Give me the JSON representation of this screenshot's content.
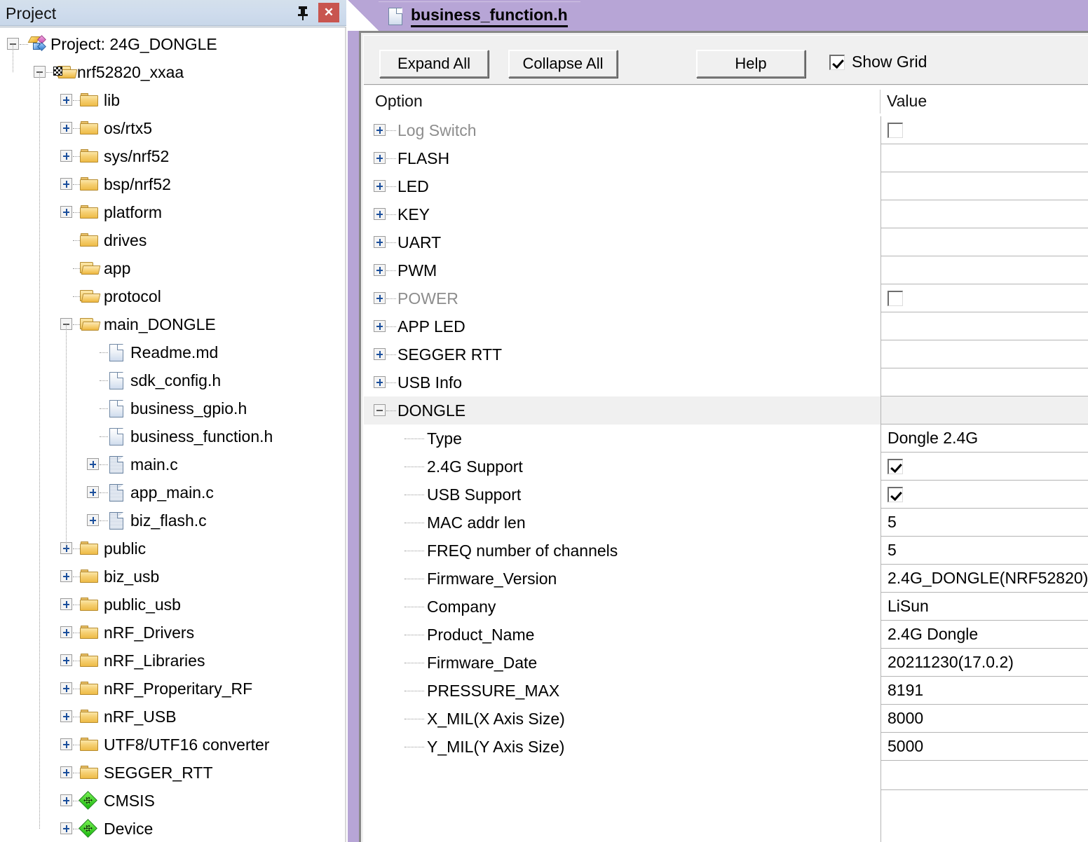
{
  "project_panel": {
    "title": "Project",
    "pin_icon": "pushpin-icon",
    "close_icon": "close-icon",
    "tree": [
      {
        "label": "Project: 24G_DONGLE",
        "depth": 0,
        "icon": "project-icon",
        "expander": "minus"
      },
      {
        "label": "nrf52820_xxaa",
        "depth": 1,
        "icon": "target-folder-icon",
        "expander": "minus"
      },
      {
        "label": "lib",
        "depth": 2,
        "icon": "folder-closed-icon",
        "expander": "plus"
      },
      {
        "label": "os/rtx5",
        "depth": 2,
        "icon": "folder-closed-icon",
        "expander": "plus"
      },
      {
        "label": "sys/nrf52",
        "depth": 2,
        "icon": "folder-closed-icon",
        "expander": "plus"
      },
      {
        "label": "bsp/nrf52",
        "depth": 2,
        "icon": "folder-closed-icon",
        "expander": "plus"
      },
      {
        "label": "platform",
        "depth": 2,
        "icon": "folder-closed-icon",
        "expander": "plus"
      },
      {
        "label": "drives",
        "depth": 2,
        "icon": "folder-closed-icon",
        "expander": "none"
      },
      {
        "label": "app",
        "depth": 2,
        "icon": "folder-open-icon",
        "expander": "none"
      },
      {
        "label": "protocol",
        "depth": 2,
        "icon": "folder-open-icon",
        "expander": "none"
      },
      {
        "label": "main_DONGLE",
        "depth": 2,
        "icon": "folder-open-icon",
        "expander": "minus"
      },
      {
        "label": "Readme.md",
        "depth": 3,
        "icon": "document-icon",
        "expander": "none"
      },
      {
        "label": "sdk_config.h",
        "depth": 3,
        "icon": "document-icon",
        "expander": "none"
      },
      {
        "label": "business_gpio.h",
        "depth": 3,
        "icon": "document-icon",
        "expander": "none"
      },
      {
        "label": "business_function.h",
        "depth": 3,
        "icon": "document-icon",
        "expander": "none"
      },
      {
        "label": "main.c",
        "depth": 3,
        "icon": "c-source-icon",
        "expander": "plus"
      },
      {
        "label": "app_main.c",
        "depth": 3,
        "icon": "c-source-icon",
        "expander": "plus"
      },
      {
        "label": "biz_flash.c",
        "depth": 3,
        "icon": "c-source-icon",
        "expander": "plus"
      },
      {
        "label": "public",
        "depth": 2,
        "icon": "folder-closed-icon",
        "expander": "plus"
      },
      {
        "label": "biz_usb",
        "depth": 2,
        "icon": "folder-closed-icon",
        "expander": "plus"
      },
      {
        "label": "public_usb",
        "depth": 2,
        "icon": "folder-closed-icon",
        "expander": "plus"
      },
      {
        "label": "nRF_Drivers",
        "depth": 2,
        "icon": "folder-closed-icon",
        "expander": "plus"
      },
      {
        "label": "nRF_Libraries",
        "depth": 2,
        "icon": "folder-closed-icon",
        "expander": "plus"
      },
      {
        "label": "nRF_Properitary_RF",
        "depth": 2,
        "icon": "folder-closed-icon",
        "expander": "plus"
      },
      {
        "label": "nRF_USB",
        "depth": 2,
        "icon": "folder-closed-icon",
        "expander": "plus"
      },
      {
        "label": "UTF8/UTF16 converter",
        "depth": 2,
        "icon": "folder-closed-icon",
        "expander": "plus"
      },
      {
        "label": "SEGGER_RTT",
        "depth": 2,
        "icon": "folder-closed-icon",
        "expander": "plus"
      },
      {
        "label": "CMSIS",
        "depth": 2,
        "icon": "green-diamond-icon",
        "expander": "plus"
      },
      {
        "label": "Device",
        "depth": 2,
        "icon": "green-diamond-icon",
        "expander": "plus"
      }
    ]
  },
  "editor": {
    "tab": {
      "label": "business_function.h",
      "icon": "document-icon",
      "active": true
    },
    "toolbar": {
      "expand_all_label": "Expand All",
      "collapse_all_label": "Collapse All",
      "help_label": "Help",
      "show_grid_label": "Show Grid",
      "show_grid_checked": true
    },
    "grid": {
      "header": {
        "option": "Option",
        "value": "Value"
      },
      "rows": [
        {
          "label": "Log Switch",
          "depth": 0,
          "expander": "plus",
          "disabled": true,
          "value_type": "checkbox",
          "checked": false,
          "value": ""
        },
        {
          "label": "FLASH",
          "depth": 0,
          "expander": "plus",
          "disabled": false,
          "value_type": "empty",
          "checked": false,
          "value": ""
        },
        {
          "label": "LED",
          "depth": 0,
          "expander": "plus",
          "disabled": false,
          "value_type": "empty",
          "checked": false,
          "value": ""
        },
        {
          "label": "KEY",
          "depth": 0,
          "expander": "plus",
          "disabled": false,
          "value_type": "empty",
          "checked": false,
          "value": ""
        },
        {
          "label": "UART",
          "depth": 0,
          "expander": "plus",
          "disabled": false,
          "value_type": "empty",
          "checked": false,
          "value": ""
        },
        {
          "label": "PWM",
          "depth": 0,
          "expander": "plus",
          "disabled": false,
          "value_type": "empty",
          "checked": false,
          "value": ""
        },
        {
          "label": "POWER",
          "depth": 0,
          "expander": "plus",
          "disabled": true,
          "value_type": "checkbox",
          "checked": false,
          "value": ""
        },
        {
          "label": "APP LED",
          "depth": 0,
          "expander": "plus",
          "disabled": false,
          "value_type": "empty",
          "checked": false,
          "value": ""
        },
        {
          "label": "SEGGER RTT",
          "depth": 0,
          "expander": "plus",
          "disabled": false,
          "value_type": "empty",
          "checked": false,
          "value": ""
        },
        {
          "label": "USB Info",
          "depth": 0,
          "expander": "plus",
          "disabled": false,
          "value_type": "empty",
          "checked": false,
          "value": ""
        },
        {
          "label": "DONGLE",
          "depth": 0,
          "expander": "minus",
          "disabled": false,
          "value_type": "empty",
          "checked": false,
          "value": "",
          "selected": true
        },
        {
          "label": "Type",
          "depth": 1,
          "expander": "none",
          "disabled": false,
          "value_type": "text",
          "value": "Dongle 2.4G"
        },
        {
          "label": "2.4G Support",
          "depth": 1,
          "expander": "none",
          "disabled": false,
          "value_type": "checkbox",
          "checked": true,
          "value": ""
        },
        {
          "label": "USB Support",
          "depth": 1,
          "expander": "none",
          "disabled": false,
          "value_type": "checkbox",
          "checked": true,
          "value": ""
        },
        {
          "label": "MAC addr len",
          "depth": 1,
          "expander": "none",
          "disabled": false,
          "value_type": "text",
          "value": "5"
        },
        {
          "label": "FREQ number of channels",
          "depth": 1,
          "expander": "none",
          "disabled": false,
          "value_type": "text",
          "value": "5"
        },
        {
          "label": "Firmware_Version",
          "depth": 1,
          "expander": "none",
          "disabled": false,
          "value_type": "text",
          "value": "2.4G_DONGLE(NRF52820)"
        },
        {
          "label": "Company",
          "depth": 1,
          "expander": "none",
          "disabled": false,
          "value_type": "text",
          "value": "LiSun"
        },
        {
          "label": "Product_Name",
          "depth": 1,
          "expander": "none",
          "disabled": false,
          "value_type": "text",
          "value": "2.4G Dongle"
        },
        {
          "label": "Firmware_Date",
          "depth": 1,
          "expander": "none",
          "disabled": false,
          "value_type": "text",
          "value": "20211230(17.0.2)"
        },
        {
          "label": "PRESSURE_MAX",
          "depth": 1,
          "expander": "none",
          "disabled": false,
          "value_type": "text",
          "value": "8191"
        },
        {
          "label": "X_MIL(X Axis Size)",
          "depth": 1,
          "expander": "none",
          "disabled": false,
          "value_type": "text",
          "value": "8000"
        },
        {
          "label": "Y_MIL(Y Axis Size)",
          "depth": 1,
          "expander": "none",
          "disabled": false,
          "value_type": "text",
          "value": "5000"
        }
      ]
    }
  }
}
